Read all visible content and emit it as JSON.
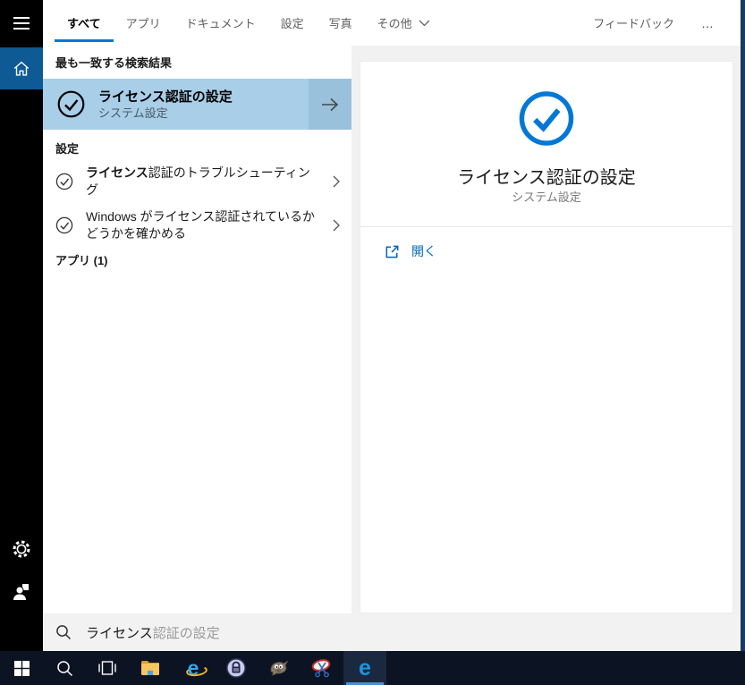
{
  "colors": {
    "accent": "#0078d7",
    "selected_row_bg": "#a8cee8",
    "selected_row_arrow_bg": "#9ac1dc",
    "home_tile_bg": "#0d5a94",
    "taskbar_bg": "#0c1322",
    "panel_gray": "#f1f1f1",
    "link_blue": "#0067b8"
  },
  "topbar": {
    "tabs": [
      {
        "label": "すべて",
        "selected": true
      },
      {
        "label": "アプリ",
        "selected": false
      },
      {
        "label": "ドキュメント",
        "selected": false
      },
      {
        "label": "設定",
        "selected": false
      },
      {
        "label": "写真",
        "selected": false
      },
      {
        "label": "その他",
        "selected": false
      }
    ],
    "feedback_label": "フィードバック",
    "more_label": "…"
  },
  "results": {
    "best_match_header": "最も一致する検索結果",
    "best_match": {
      "title": "ライセンス認証の設定",
      "subtitle": "システム設定"
    },
    "settings_header": "設定",
    "settings_items": [
      {
        "bold": "ライセンス",
        "rest": "認証のトラブルシューティング"
      },
      {
        "bold": "",
        "rest": "Windows がライセンス認証されているかどうかを確かめる"
      }
    ],
    "apps_header": "アプリ (1)"
  },
  "preview": {
    "title": "ライセンス認証の設定",
    "subtitle": "システム設定",
    "open_label": "開く"
  },
  "search_box": {
    "typed": "ライセンス",
    "suggestion": "認証の設定"
  },
  "sidebar": {
    "icons": [
      "hamburger-menu",
      "home",
      "settings-gear",
      "user-account"
    ]
  },
  "taskbar": {
    "icons": [
      "start",
      "search",
      "task-view",
      "file-explorer",
      "internet-explorer",
      "keepass",
      "gimp",
      "snipping-tool",
      "edge"
    ],
    "active_icon": "edge"
  }
}
